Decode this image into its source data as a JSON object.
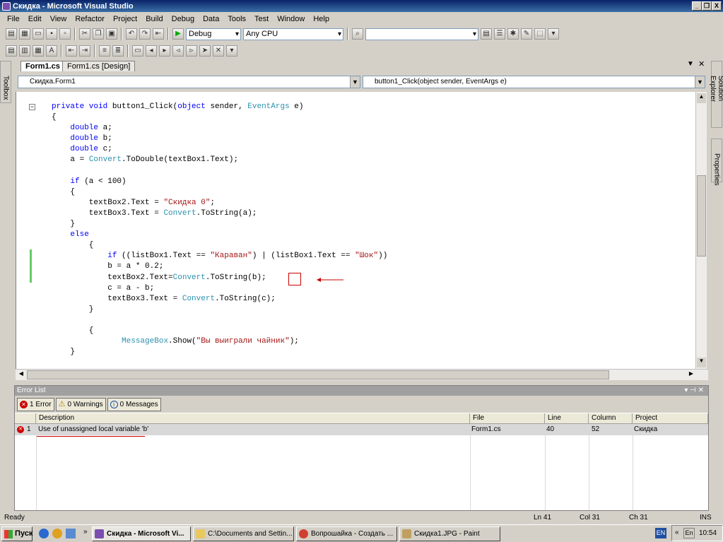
{
  "window": {
    "title": "Скидка - Microsoft Visual Studio",
    "buttons": [
      "_",
      "❐",
      "X"
    ]
  },
  "menu": [
    "File",
    "Edit",
    "View",
    "Refactor",
    "Project",
    "Build",
    "Debug",
    "Data",
    "Tools",
    "Test",
    "Window",
    "Help"
  ],
  "toolbar": {
    "config": "Debug",
    "platform": "Any CPU",
    "find_value": ""
  },
  "side_tabs": {
    "left": "Toolbox",
    "right_top": "Solution Explorer",
    "right_bottom": "Properties"
  },
  "tabs": [
    {
      "label": "Form1.cs"
    },
    {
      "label": "Form1.cs [Design]"
    }
  ],
  "tab_controls": {
    "dropdown": "▼",
    "close": "✕"
  },
  "nav": {
    "class_combo": "Скидка.Form1",
    "member_combo": "button1_Click(object sender, EventArgs e)"
  },
  "code_lines": [
    [
      {
        "t": "private void ",
        "c": "kw"
      },
      {
        "t": "button1_Click(",
        "c": ""
      },
      {
        "t": "object",
        "c": "kw"
      },
      {
        "t": " sender, ",
        "c": ""
      },
      {
        "t": "EventArgs",
        "c": "ty"
      },
      {
        "t": " e)",
        "c": ""
      }
    ],
    [
      {
        "t": "{",
        "c": ""
      }
    ],
    [
      {
        "t": "    ",
        "c": ""
      },
      {
        "t": "double",
        "c": "kw"
      },
      {
        "t": " a;",
        "c": ""
      }
    ],
    [
      {
        "t": "    ",
        "c": ""
      },
      {
        "t": "double",
        "c": "kw"
      },
      {
        "t": " b;",
        "c": ""
      }
    ],
    [
      {
        "t": "    ",
        "c": ""
      },
      {
        "t": "double",
        "c": "kw"
      },
      {
        "t": " c;",
        "c": ""
      }
    ],
    [
      {
        "t": "    a = ",
        "c": ""
      },
      {
        "t": "Convert",
        "c": "ty"
      },
      {
        "t": ".ToDouble(textBox1.Text);",
        "c": ""
      }
    ],
    [
      {
        "t": "",
        "c": ""
      }
    ],
    [
      {
        "t": "    ",
        "c": ""
      },
      {
        "t": "if",
        "c": "kw"
      },
      {
        "t": " (a < 100)",
        "c": ""
      }
    ],
    [
      {
        "t": "    {",
        "c": ""
      }
    ],
    [
      {
        "t": "        textBox2.Text = ",
        "c": ""
      },
      {
        "t": "\"Скидка 0\"",
        "c": "st"
      },
      {
        "t": ";",
        "c": ""
      }
    ],
    [
      {
        "t": "        textBox3.Text = ",
        "c": ""
      },
      {
        "t": "Convert",
        "c": "ty"
      },
      {
        "t": ".ToString(a);",
        "c": ""
      }
    ],
    [
      {
        "t": "    }",
        "c": ""
      }
    ],
    [
      {
        "t": "    ",
        "c": ""
      },
      {
        "t": "else",
        "c": "kw"
      }
    ],
    [
      {
        "t": "        {",
        "c": ""
      }
    ],
    [
      {
        "t": "            ",
        "c": ""
      },
      {
        "t": "if",
        "c": "kw"
      },
      {
        "t": " ((listBox1.Text == ",
        "c": ""
      },
      {
        "t": "\"Караван\"",
        "c": "st"
      },
      {
        "t": ") | (listBox1.Text == ",
        "c": ""
      },
      {
        "t": "\"Шок\"",
        "c": "st"
      },
      {
        "t": "))",
        "c": ""
      }
    ],
    [
      {
        "t": "            b = a * 0.2;",
        "c": ""
      }
    ],
    [
      {
        "t": "            textBox2.Text=",
        "c": ""
      },
      {
        "t": "Convert",
        "c": "ty"
      },
      {
        "t": ".ToString(b);",
        "c": ""
      }
    ],
    [
      {
        "t": "            c = a - b;",
        "c": ""
      }
    ],
    [
      {
        "t": "            textBox3.Text = ",
        "c": ""
      },
      {
        "t": "Convert",
        "c": "ty"
      },
      {
        "t": ".ToString(c);",
        "c": ""
      }
    ],
    [
      {
        "t": "        }",
        "c": ""
      }
    ],
    [
      {
        "t": "",
        "c": ""
      }
    ],
    [
      {
        "t": "        {",
        "c": ""
      }
    ],
    [
      {
        "t": "               ",
        "c": ""
      },
      {
        "t": "MessageBox",
        "c": "ty"
      },
      {
        "t": ".Show(",
        "c": ""
      },
      {
        "t": "\"Вы выиграли чайник\"",
        "c": "st"
      },
      {
        "t": ");",
        "c": ""
      }
    ],
    [
      {
        "t": "    }",
        "c": ""
      }
    ]
  ],
  "error_list": {
    "title": "Error List",
    "filters": {
      "errors": "1 Error",
      "warnings": "0 Warnings",
      "messages": "0 Messages"
    },
    "columns": {
      "description": "Description",
      "file": "File",
      "line": "Line",
      "column": "Column",
      "project": "Project"
    },
    "rows": [
      {
        "num": "1",
        "description": "Use of unassigned local variable 'b'",
        "file": "Form1.cs",
        "line": "40",
        "column": "52",
        "project": "Скидка"
      }
    ]
  },
  "status": {
    "text": "Ready",
    "ln": "Ln 41",
    "col": "Col 31",
    "ch": "Ch 31",
    "mode": "INS"
  },
  "taskbar": {
    "start": "Пуск",
    "tasks": [
      {
        "label": "Скидка - Microsoft Vi...",
        "active": true
      },
      {
        "label": "C:\\Documents and Settin...",
        "active": false
      },
      {
        "label": "Вопрошайка - Создать ...",
        "active": false
      },
      {
        "label": "Скидка1.JPG - Paint",
        "active": false
      }
    ],
    "lang": "EN",
    "lang2": "En",
    "clock": "10:54"
  },
  "colors": {
    "keyword": "#0000ff",
    "type": "#2b91af",
    "string": "#a31515",
    "annotation": "#cc0000"
  }
}
